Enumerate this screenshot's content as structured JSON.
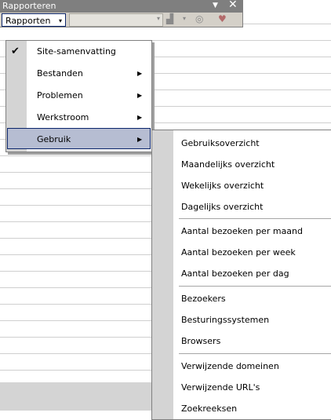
{
  "toolbar": {
    "title": "Rapporteren",
    "dropdown_glyph": "▼",
    "close_glyph": "✕",
    "reports_button_label": "Rapporten",
    "reports_button_arrow": "▾",
    "combo_arrow": "▾",
    "chart_icon": "chart-icon",
    "chart_glyph": "▟",
    "chart_arrow": "▾",
    "globe_icon": "globe-icon",
    "globe_glyph": "◎",
    "spell_icon": "spellcheck-icon",
    "spell_glyph": "♥"
  },
  "menu": {
    "check_glyph": "✔",
    "sub_arrow": "▶",
    "items": [
      {
        "label": "Site-samenvatting",
        "checked": true,
        "submenu": false
      },
      {
        "label": "Bestanden",
        "checked": false,
        "submenu": true
      },
      {
        "label": "Problemen",
        "checked": false,
        "submenu": true
      },
      {
        "label": "Werkstroom",
        "checked": false,
        "submenu": true
      },
      {
        "label": "Gebruik",
        "checked": false,
        "submenu": true,
        "highlighted": true
      }
    ]
  },
  "submenu": {
    "items": [
      "Gebruiksoverzicht",
      "Maandelijks overzicht",
      "Wekelijks overzicht",
      "Dagelijks overzicht",
      "Aantal bezoeken per maand",
      "Aantal bezoeken per week",
      "Aantal bezoeken per dag",
      "Bezoekers",
      "Besturingssystemen",
      "Browsers",
      "Verwijzende domeinen",
      "Verwijzende URL's",
      "Zoekreeksen"
    ]
  }
}
